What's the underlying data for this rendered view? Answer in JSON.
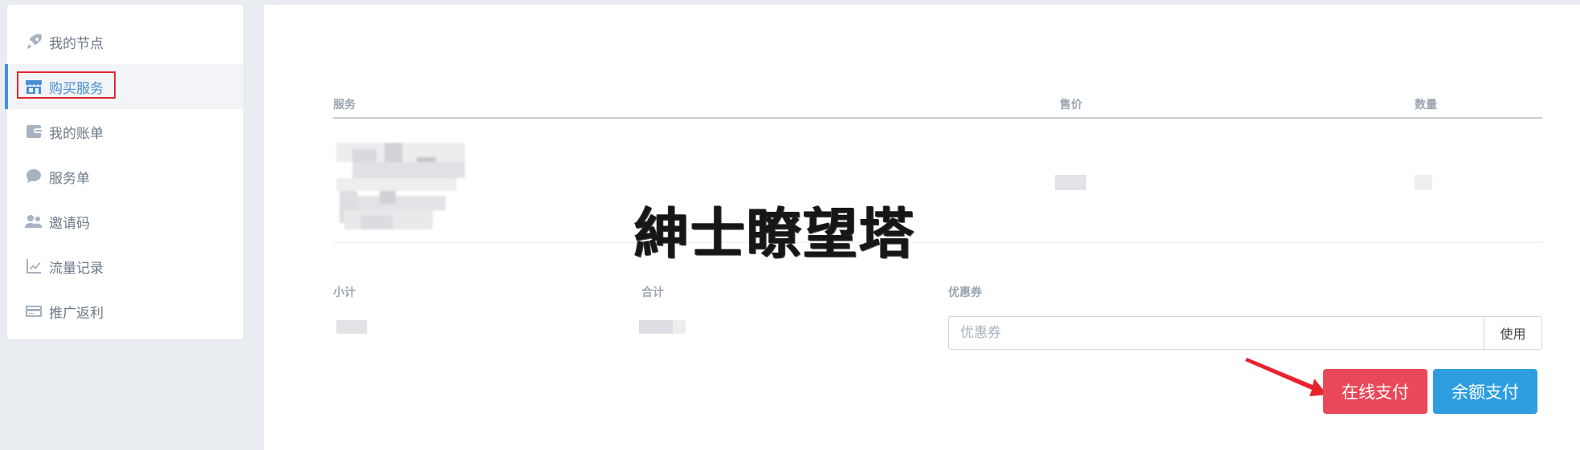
{
  "sidebar": {
    "items": [
      {
        "label": "我的节点",
        "icon": "rocket-icon",
        "active": false
      },
      {
        "label": "购买服务",
        "icon": "store-icon",
        "active": true
      },
      {
        "label": "我的账单",
        "icon": "wallet-icon",
        "active": false
      },
      {
        "label": "服务单",
        "icon": "chat-bubble-icon",
        "active": false
      },
      {
        "label": "邀请码",
        "icon": "users-icon",
        "active": false
      },
      {
        "label": "流量记录",
        "icon": "line-chart-icon",
        "active": false
      },
      {
        "label": "推广返利",
        "icon": "credit-card-icon",
        "active": false
      }
    ]
  },
  "table": {
    "columns": [
      "服务",
      "售价",
      "数量"
    ]
  },
  "summary": {
    "subtotal_label": "小计",
    "total_label": "合计",
    "coupon_label": "优惠券"
  },
  "coupon": {
    "placeholder": "优惠券",
    "apply_label": "使用"
  },
  "actions": {
    "online_pay": "在线支付",
    "balance_pay": "余额支付"
  },
  "watermark": "紳士瞭望塔",
  "colors": {
    "accent": "#4a8fd6",
    "online_pay": "#e94858",
    "balance_pay": "#2f9ee0",
    "highlight": "#e0262f"
  }
}
